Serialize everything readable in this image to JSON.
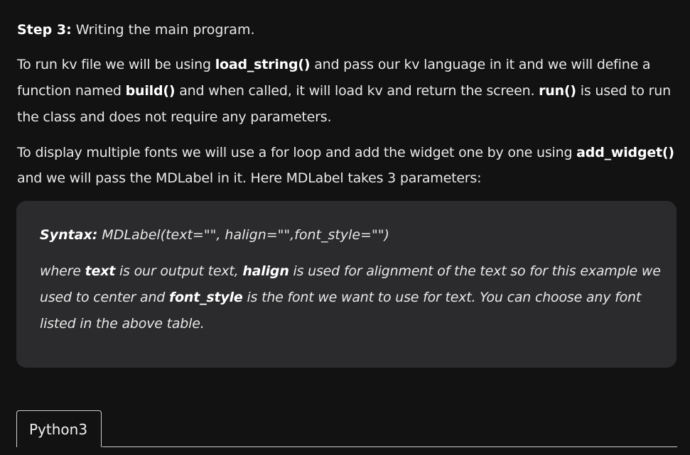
{
  "step": {
    "label": "Step 3:",
    "title": " Writing the main program."
  },
  "para1": {
    "t1": "To run kv file we will be using ",
    "b1": "load_string()",
    "t2": " and pass our kv language in it and we will define a function named ",
    "b2": "build()",
    "t3": " and when called, it will load kv and return the screen. ",
    "b3": "run()",
    "t4": " is used to run the class and does not require any parameters."
  },
  "para2": {
    "t1": "To display multiple fonts we will use a for loop and add the widget one by one using ",
    "b1": "add_widget()",
    "t2": " and we will pass the MDLabel in it. Here MDLabel takes 3 parameters:"
  },
  "syntax": {
    "label": "Syntax:",
    "code": " MDLabel(text=\"\", halign=\"\",font_style=\"\")",
    "d1": "where ",
    "b1": "text",
    "d2": " is our output text, ",
    "b2": "halign",
    "d3": " is used for alignment of the text so for this example we used to center and ",
    "b3": "font_style",
    "d4": " is the font we want to use for text. You can choose any font listed in the above table."
  },
  "code_tab": {
    "label": "Python3"
  }
}
